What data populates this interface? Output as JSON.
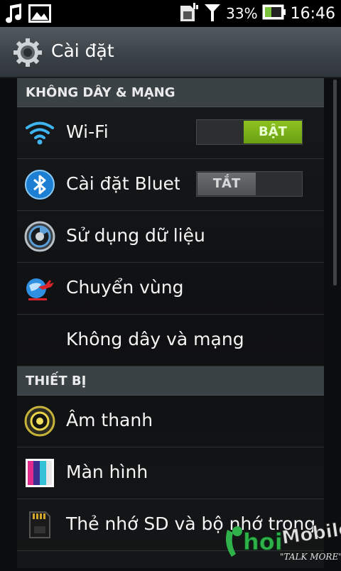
{
  "status_bar": {
    "battery_text": "33%",
    "time": "16:46",
    "icons": [
      "music-icon",
      "image-icon",
      "sim-icon",
      "signal-icon",
      "battery-icon"
    ]
  },
  "action_bar": {
    "title": "Cài đặt",
    "icon": "settings-gear-icon"
  },
  "sections": [
    {
      "header": "KHÔNG DÂY & MẠNG",
      "items": [
        {
          "label": "Wi-Fi",
          "icon": "wifi-icon",
          "toggle": "BẬT"
        },
        {
          "label": "Cài đặt Bluetooth",
          "icon": "bluetooth-icon",
          "toggle": "TẮT"
        },
        {
          "label": "Sử dụng dữ liệu",
          "icon": "data-usage-icon"
        },
        {
          "label": "Chuyển vùng",
          "icon": "roaming-icon"
        },
        {
          "label": "Không dây và mạng",
          "icon": ""
        }
      ]
    },
    {
      "header": "THIẾT BỊ",
      "items": [
        {
          "label": "Âm thanh",
          "icon": "sound-icon"
        },
        {
          "label": "Màn hình",
          "icon": "display-icon"
        },
        {
          "label": "Thẻ nhớ SD và bộ nhớ trong",
          "icon": "sd-card-icon"
        }
      ]
    }
  ],
  "watermark": {
    "brand": "hoiMobile",
    "tagline": "\"TALK MORE\""
  },
  "colors": {
    "toggle_on": "#7db51a",
    "section_bg": "#3a4246",
    "actionbar": "#40474c"
  }
}
